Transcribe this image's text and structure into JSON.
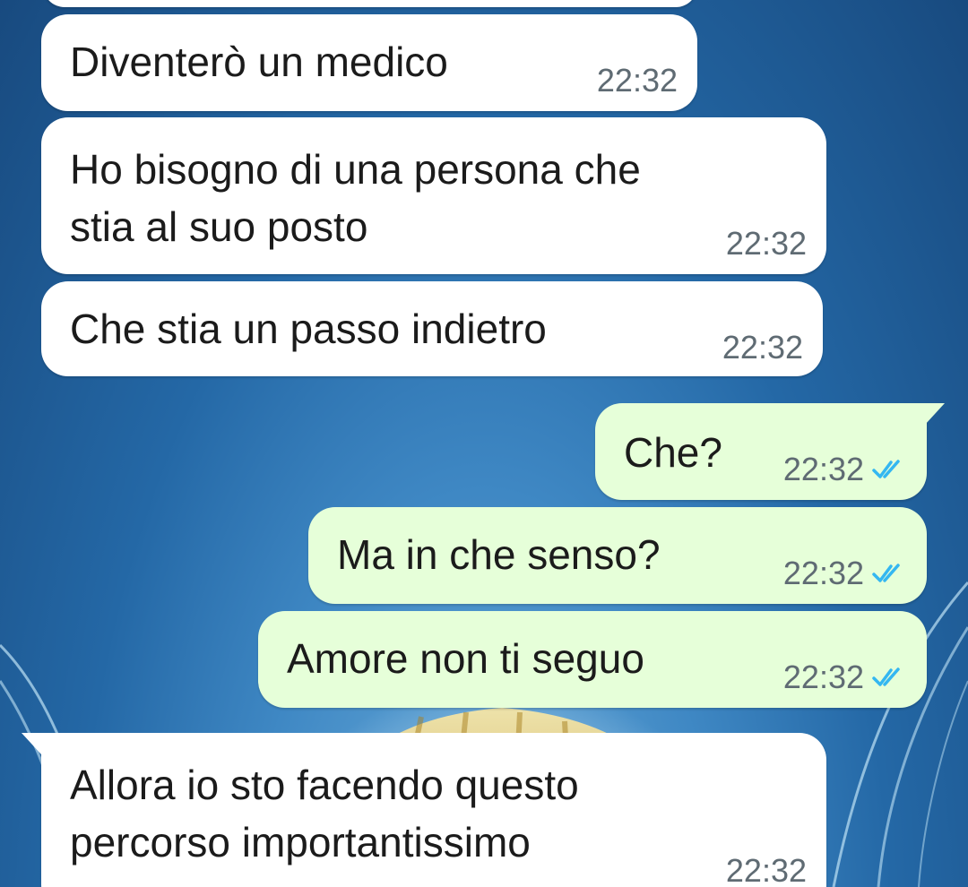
{
  "messages": [
    {
      "text": "Diventerò un medico",
      "time": "22:32",
      "direction": "incoming"
    },
    {
      "text": "Ho bisogno di una persona che\nstia al suo posto",
      "time": "22:32",
      "direction": "incoming"
    },
    {
      "text": "Che stia un passo indietro",
      "time": "22:32",
      "direction": "incoming"
    },
    {
      "text": "Che?",
      "time": "22:32",
      "direction": "outgoing",
      "status": "read"
    },
    {
      "text": "Ma in che senso?",
      "time": "22:32",
      "direction": "outgoing",
      "status": "read"
    },
    {
      "text": "Amore non ti seguo",
      "time": "22:32",
      "direction": "outgoing",
      "status": "read"
    },
    {
      "text": "Allora io sto facendo questo\npercorso importantissimo",
      "time": "22:32",
      "direction": "incoming"
    }
  ],
  "colors": {
    "incoming_bubble": "#ffffff",
    "outgoing_bubble": "#e6ffd9",
    "read_ticks": "#34b7f1",
    "timestamp": "#5f6b73"
  },
  "icons": {
    "read_receipt": "double-check-icon"
  }
}
